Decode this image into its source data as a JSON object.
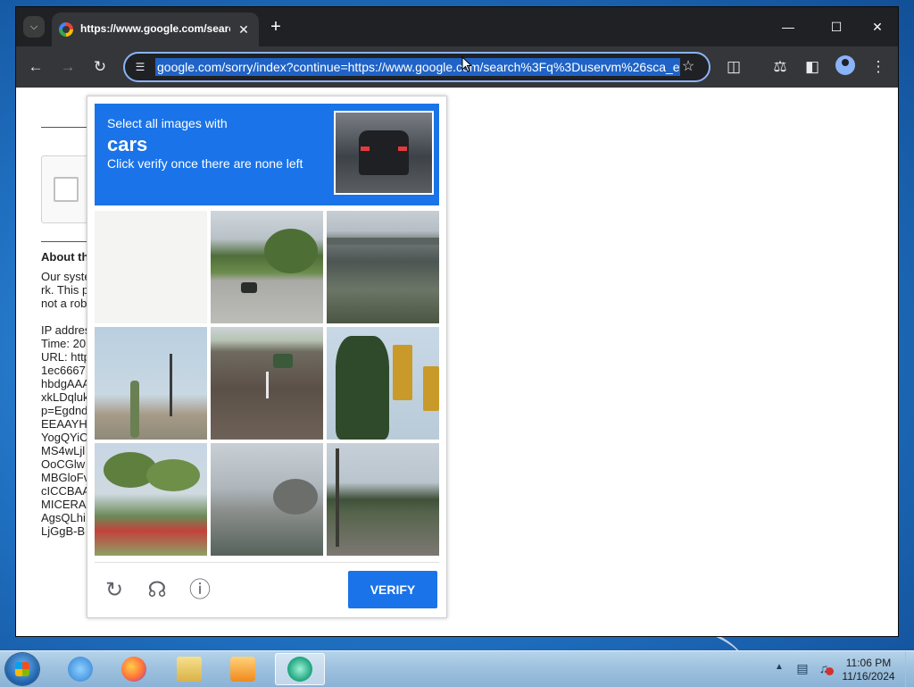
{
  "browser": {
    "tab_title": "https://www.google.com/search",
    "url": "google.com/sorry/index?continue=https://www.google.com/search%3Fq%3Duservm%26sca_e",
    "icons": {
      "tab_search": "chevron-down-icon",
      "tab_close": "close-icon",
      "new_tab": "plus-icon",
      "minimize": "minimize-icon",
      "maximize": "maximize-icon",
      "close": "close-icon",
      "back": "arrow-left-icon",
      "forward": "arrow-right-icon",
      "reload": "reload-icon",
      "site_info": "tune-icon",
      "bookmark": "star-icon",
      "extensions": "puzzle-icon",
      "labs": "flask-icon",
      "side_panel": "side-panel-icon",
      "profile": "profile-icon",
      "menu": "kebab-menu-icon"
    }
  },
  "page": {
    "about_heading": "About th",
    "paragraph_lines": [
      "Our syste",
      "rk. This p",
      "not a rob"
    ],
    "info_lines": [
      "IP addres",
      "Time: 20",
      "URL: http",
      "1ec6667",
      "hbdgAAA",
      "xkLDqluk",
      "p=Egdnd",
      "EEAAYH",
      "YogQYiC",
      "MS4wLjl",
      "OoCGlw",
      "MBGloFv",
      "cICCBAA",
      "MICERA",
      "AgsQLhi",
      "LjGgB-B"
    ]
  },
  "captcha": {
    "instruction_line1": "Select all images with",
    "target_word": "cars",
    "instruction_line3": "Click verify once there are none left",
    "verify_label": "VERIFY",
    "tiles_count": 9,
    "footer_icons": [
      "reload-icon",
      "headphones-icon",
      "info-icon"
    ],
    "accent_color": "#1a73e8"
  },
  "taskbar": {
    "apps": [
      "internet-explorer-icon",
      "firefox-icon",
      "file-explorer-icon",
      "media-player-icon",
      "chrome-canary-icon"
    ],
    "time": "11:06 PM",
    "date": "11/16/2024"
  }
}
